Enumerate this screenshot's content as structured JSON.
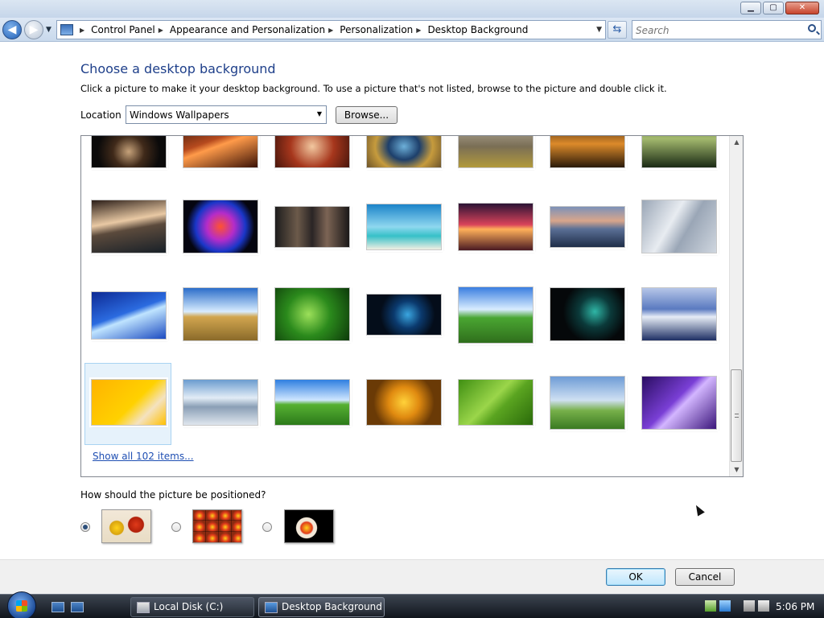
{
  "window": {
    "minimize": "▁",
    "maximize": "▢",
    "close": "✕"
  },
  "nav": {
    "back_icon": "arrow-left",
    "forward_icon": "arrow-right",
    "breadcrumbs": [
      "Control Panel",
      "Appearance and Personalization",
      "Personalization",
      "Desktop Background"
    ],
    "search_placeholder": "Search"
  },
  "main": {
    "heading": "Choose a desktop background",
    "instructions": "Click a picture to make it your desktop background. To use a picture that's not listed, browse to the picture and double click it.",
    "location_label": "Location",
    "location_value": "Windows Wallpapers",
    "browse_label": "Browse...",
    "show_all_link": "Show all 102 items...",
    "position_label": "How should the picture be positioned?",
    "position_options": [
      "fill",
      "tile",
      "center"
    ],
    "position_selected": "fill"
  },
  "footer": {
    "ok_label": "OK",
    "cancel_label": "Cancel"
  },
  "taskbar": {
    "tasks": [
      "Local Disk (C:)",
      "Desktop Background"
    ],
    "active_task": "Desktop Background",
    "clock": "5:06 PM"
  },
  "colors": {
    "heading": "#1e3f8a",
    "link": "#1f4fb3",
    "selection": "#e6f2fb"
  }
}
